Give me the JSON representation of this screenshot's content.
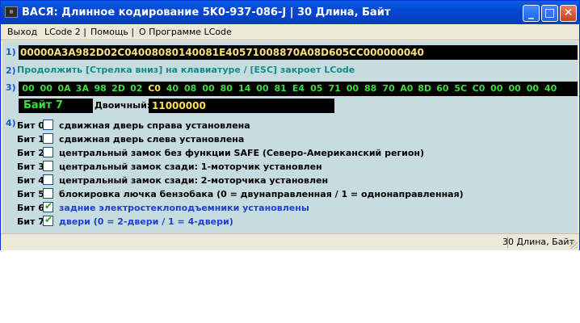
{
  "window": {
    "title": "ВАСЯ: Длинное кодирование  5K0-937-086-J  |  30 Длина, Байт",
    "icon": "app-icon",
    "controls": {
      "minimize": "_",
      "maximize": "□",
      "close": "✕"
    }
  },
  "menu": {
    "items": [
      "Выход",
      "LCode 2 |",
      "Помощь |",
      "О Программе LCode"
    ]
  },
  "section_numbers": [
    "1)",
    "2)",
    "3)",
    "4)"
  ],
  "coding_string": "00000A3A982D02C04008080140081E40571008870A08D605CC000000040",
  "hint": "Продолжить [Стрелка вниз] на клавиатуре / [ESC] закроет LCode",
  "bytes": [
    "00",
    "00",
    "0A",
    "3A",
    "98",
    "2D",
    "02",
    "C0",
    "40",
    "08",
    "00",
    "80",
    "14",
    "00",
    "81",
    "E4",
    "05",
    "71",
    "00",
    "88",
    "70",
    "A0",
    "8D",
    "60",
    "5C",
    "C0",
    "00",
    "00",
    "00",
    "40"
  ],
  "selected_byte_index": 7,
  "byte_label": "Байт 7",
  "binary_label": "Двоичный:",
  "binary_value": "11000000",
  "bits": [
    {
      "name": "Бит 0",
      "checked": false,
      "desc": "сдвижная дверь справа установлена"
    },
    {
      "name": "Бит 1",
      "checked": false,
      "desc": "сдвижная дверь слева установлена"
    },
    {
      "name": "Бит 2",
      "checked": false,
      "desc": "центральный замок без функции SAFE (Северо-Американский регион)"
    },
    {
      "name": "Бит 3",
      "checked": false,
      "desc": "центральный замок сзади: 1-моторчик установлен"
    },
    {
      "name": "Бит 4",
      "checked": false,
      "desc": "центральный замок сзади: 2-моторчика установлен"
    },
    {
      "name": "Бит 5",
      "checked": false,
      "desc": "блокировка лючка бензобака (0 = двунаправленная / 1 = однонаправленная)"
    },
    {
      "name": "Бит 6",
      "checked": true,
      "desc": "задние электростеклоподъемники установлены"
    },
    {
      "name": "Бит 7",
      "checked": true,
      "desc": "двери (0 = 2-двери / 1 = 4-двери)"
    }
  ],
  "status": "30 Длина, Байт",
  "colors": {
    "titlebar": "#0546d1",
    "panel": "#c7dcdf",
    "hex_text": "#f6e07a",
    "byte_text": "#3adf3a",
    "checked_text": "#1f3fd0",
    "hint_text": "#148a8a"
  }
}
